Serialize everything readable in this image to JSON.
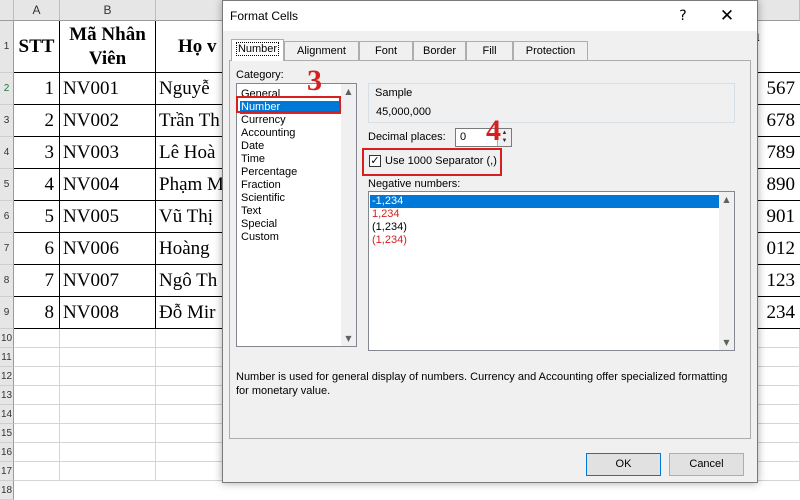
{
  "sheet": {
    "columns": [
      "A",
      "B"
    ],
    "rows": [
      "1",
      "2",
      "3",
      "4",
      "5",
      "6",
      "7",
      "8",
      "9",
      "10",
      "11",
      "12",
      "13",
      "14",
      "15",
      "16",
      "17",
      "18"
    ],
    "header": {
      "stt": "STT",
      "ma_nv_line1": "Mã Nhân",
      "ma_nv_line2": "Viên",
      "ho_ten": "Họ v",
      "right_col": "n"
    },
    "records": [
      {
        "stt": "1",
        "ma": "NV001",
        "ten": "Nguyễ",
        "right": "567"
      },
      {
        "stt": "2",
        "ma": "NV002",
        "ten": "Trần Th",
        "right": "678"
      },
      {
        "stt": "3",
        "ma": "NV003",
        "ten": "Lê Hoà",
        "right": "789"
      },
      {
        "stt": "4",
        "ma": "NV004",
        "ten": "Phạm M",
        "right": "890"
      },
      {
        "stt": "5",
        "ma": "NV005",
        "ten": "Vũ Thị",
        "right": "901"
      },
      {
        "stt": "6",
        "ma": "NV006",
        "ten": "Hoàng",
        "right": "012"
      },
      {
        "stt": "7",
        "ma": "NV007",
        "ten": "Ngô Th",
        "right": "123"
      },
      {
        "stt": "8",
        "ma": "NV008",
        "ten": "Đỗ Mir",
        "right": "234"
      }
    ]
  },
  "dialog": {
    "title": "Format Cells",
    "help_icon": "?",
    "close_icon": "✕",
    "tabs": [
      "Number",
      "Alignment",
      "Font",
      "Border",
      "Fill",
      "Protection"
    ],
    "active_tab": "Number",
    "category_label": "Category:",
    "categories": [
      "General",
      "Number",
      "Currency",
      "Accounting",
      "Date",
      "Time",
      "Percentage",
      "Fraction",
      "Scientific",
      "Text",
      "Special",
      "Custom"
    ],
    "selected_category": "Number",
    "sample_label": "Sample",
    "sample_value": "45,000,000",
    "decimal_places_label": "Decimal places:",
    "decimal_places_value": "0",
    "use_separator_label": "Use 1000 Separator (,)",
    "use_separator_checked": true,
    "negative_numbers_label": "Negative numbers:",
    "negative_options": [
      "-1,234",
      "1,234",
      "(1,234)",
      "(1,234)"
    ],
    "negative_selected_index": 0,
    "description": "Number is used for general display of numbers.  Currency and Accounting offer specialized formatting for monetary value.",
    "ok_label": "OK",
    "cancel_label": "Cancel"
  },
  "annotations": {
    "step3": "3",
    "step4": "4"
  },
  "colors": {
    "accent": "#0078d7",
    "annotation_red": "#d61f1f",
    "negative_red": "#d61f1f"
  }
}
